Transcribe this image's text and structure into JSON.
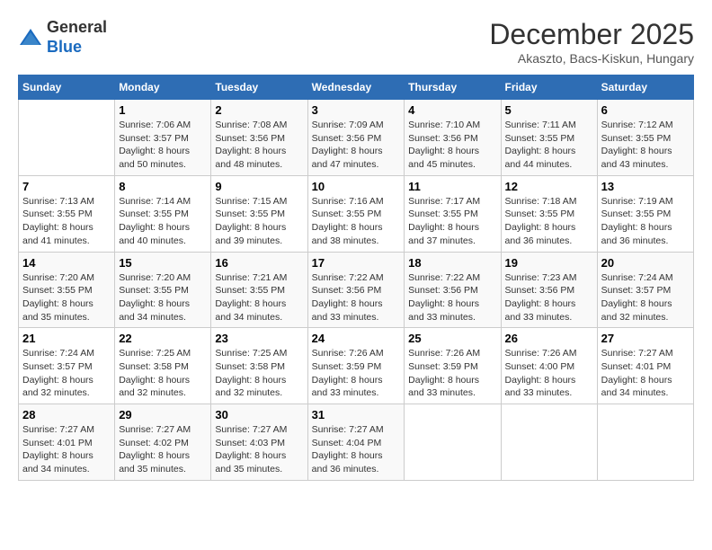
{
  "header": {
    "logo_line1": "General",
    "logo_line2": "Blue",
    "month_title": "December 2025",
    "location": "Akaszto, Bacs-Kiskun, Hungary"
  },
  "days_of_week": [
    "Sunday",
    "Monday",
    "Tuesday",
    "Wednesday",
    "Thursday",
    "Friday",
    "Saturday"
  ],
  "weeks": [
    [
      {
        "day": "",
        "info": ""
      },
      {
        "day": "1",
        "info": "Sunrise: 7:06 AM\nSunset: 3:57 PM\nDaylight: 8 hours\nand 50 minutes."
      },
      {
        "day": "2",
        "info": "Sunrise: 7:08 AM\nSunset: 3:56 PM\nDaylight: 8 hours\nand 48 minutes."
      },
      {
        "day": "3",
        "info": "Sunrise: 7:09 AM\nSunset: 3:56 PM\nDaylight: 8 hours\nand 47 minutes."
      },
      {
        "day": "4",
        "info": "Sunrise: 7:10 AM\nSunset: 3:56 PM\nDaylight: 8 hours\nand 45 minutes."
      },
      {
        "day": "5",
        "info": "Sunrise: 7:11 AM\nSunset: 3:55 PM\nDaylight: 8 hours\nand 44 minutes."
      },
      {
        "day": "6",
        "info": "Sunrise: 7:12 AM\nSunset: 3:55 PM\nDaylight: 8 hours\nand 43 minutes."
      }
    ],
    [
      {
        "day": "7",
        "info": "Sunrise: 7:13 AM\nSunset: 3:55 PM\nDaylight: 8 hours\nand 41 minutes."
      },
      {
        "day": "8",
        "info": "Sunrise: 7:14 AM\nSunset: 3:55 PM\nDaylight: 8 hours\nand 40 minutes."
      },
      {
        "day": "9",
        "info": "Sunrise: 7:15 AM\nSunset: 3:55 PM\nDaylight: 8 hours\nand 39 minutes."
      },
      {
        "day": "10",
        "info": "Sunrise: 7:16 AM\nSunset: 3:55 PM\nDaylight: 8 hours\nand 38 minutes."
      },
      {
        "day": "11",
        "info": "Sunrise: 7:17 AM\nSunset: 3:55 PM\nDaylight: 8 hours\nand 37 minutes."
      },
      {
        "day": "12",
        "info": "Sunrise: 7:18 AM\nSunset: 3:55 PM\nDaylight: 8 hours\nand 36 minutes."
      },
      {
        "day": "13",
        "info": "Sunrise: 7:19 AM\nSunset: 3:55 PM\nDaylight: 8 hours\nand 36 minutes."
      }
    ],
    [
      {
        "day": "14",
        "info": "Sunrise: 7:20 AM\nSunset: 3:55 PM\nDaylight: 8 hours\nand 35 minutes."
      },
      {
        "day": "15",
        "info": "Sunrise: 7:20 AM\nSunset: 3:55 PM\nDaylight: 8 hours\nand 34 minutes."
      },
      {
        "day": "16",
        "info": "Sunrise: 7:21 AM\nSunset: 3:55 PM\nDaylight: 8 hours\nand 34 minutes."
      },
      {
        "day": "17",
        "info": "Sunrise: 7:22 AM\nSunset: 3:56 PM\nDaylight: 8 hours\nand 33 minutes."
      },
      {
        "day": "18",
        "info": "Sunrise: 7:22 AM\nSunset: 3:56 PM\nDaylight: 8 hours\nand 33 minutes."
      },
      {
        "day": "19",
        "info": "Sunrise: 7:23 AM\nSunset: 3:56 PM\nDaylight: 8 hours\nand 33 minutes."
      },
      {
        "day": "20",
        "info": "Sunrise: 7:24 AM\nSunset: 3:57 PM\nDaylight: 8 hours\nand 32 minutes."
      }
    ],
    [
      {
        "day": "21",
        "info": "Sunrise: 7:24 AM\nSunset: 3:57 PM\nDaylight: 8 hours\nand 32 minutes."
      },
      {
        "day": "22",
        "info": "Sunrise: 7:25 AM\nSunset: 3:58 PM\nDaylight: 8 hours\nand 32 minutes."
      },
      {
        "day": "23",
        "info": "Sunrise: 7:25 AM\nSunset: 3:58 PM\nDaylight: 8 hours\nand 32 minutes."
      },
      {
        "day": "24",
        "info": "Sunrise: 7:26 AM\nSunset: 3:59 PM\nDaylight: 8 hours\nand 33 minutes."
      },
      {
        "day": "25",
        "info": "Sunrise: 7:26 AM\nSunset: 3:59 PM\nDaylight: 8 hours\nand 33 minutes."
      },
      {
        "day": "26",
        "info": "Sunrise: 7:26 AM\nSunset: 4:00 PM\nDaylight: 8 hours\nand 33 minutes."
      },
      {
        "day": "27",
        "info": "Sunrise: 7:27 AM\nSunset: 4:01 PM\nDaylight: 8 hours\nand 34 minutes."
      }
    ],
    [
      {
        "day": "28",
        "info": "Sunrise: 7:27 AM\nSunset: 4:01 PM\nDaylight: 8 hours\nand 34 minutes."
      },
      {
        "day": "29",
        "info": "Sunrise: 7:27 AM\nSunset: 4:02 PM\nDaylight: 8 hours\nand 35 minutes."
      },
      {
        "day": "30",
        "info": "Sunrise: 7:27 AM\nSunset: 4:03 PM\nDaylight: 8 hours\nand 35 minutes."
      },
      {
        "day": "31",
        "info": "Sunrise: 7:27 AM\nSunset: 4:04 PM\nDaylight: 8 hours\nand 36 minutes."
      },
      {
        "day": "",
        "info": ""
      },
      {
        "day": "",
        "info": ""
      },
      {
        "day": "",
        "info": ""
      }
    ]
  ]
}
